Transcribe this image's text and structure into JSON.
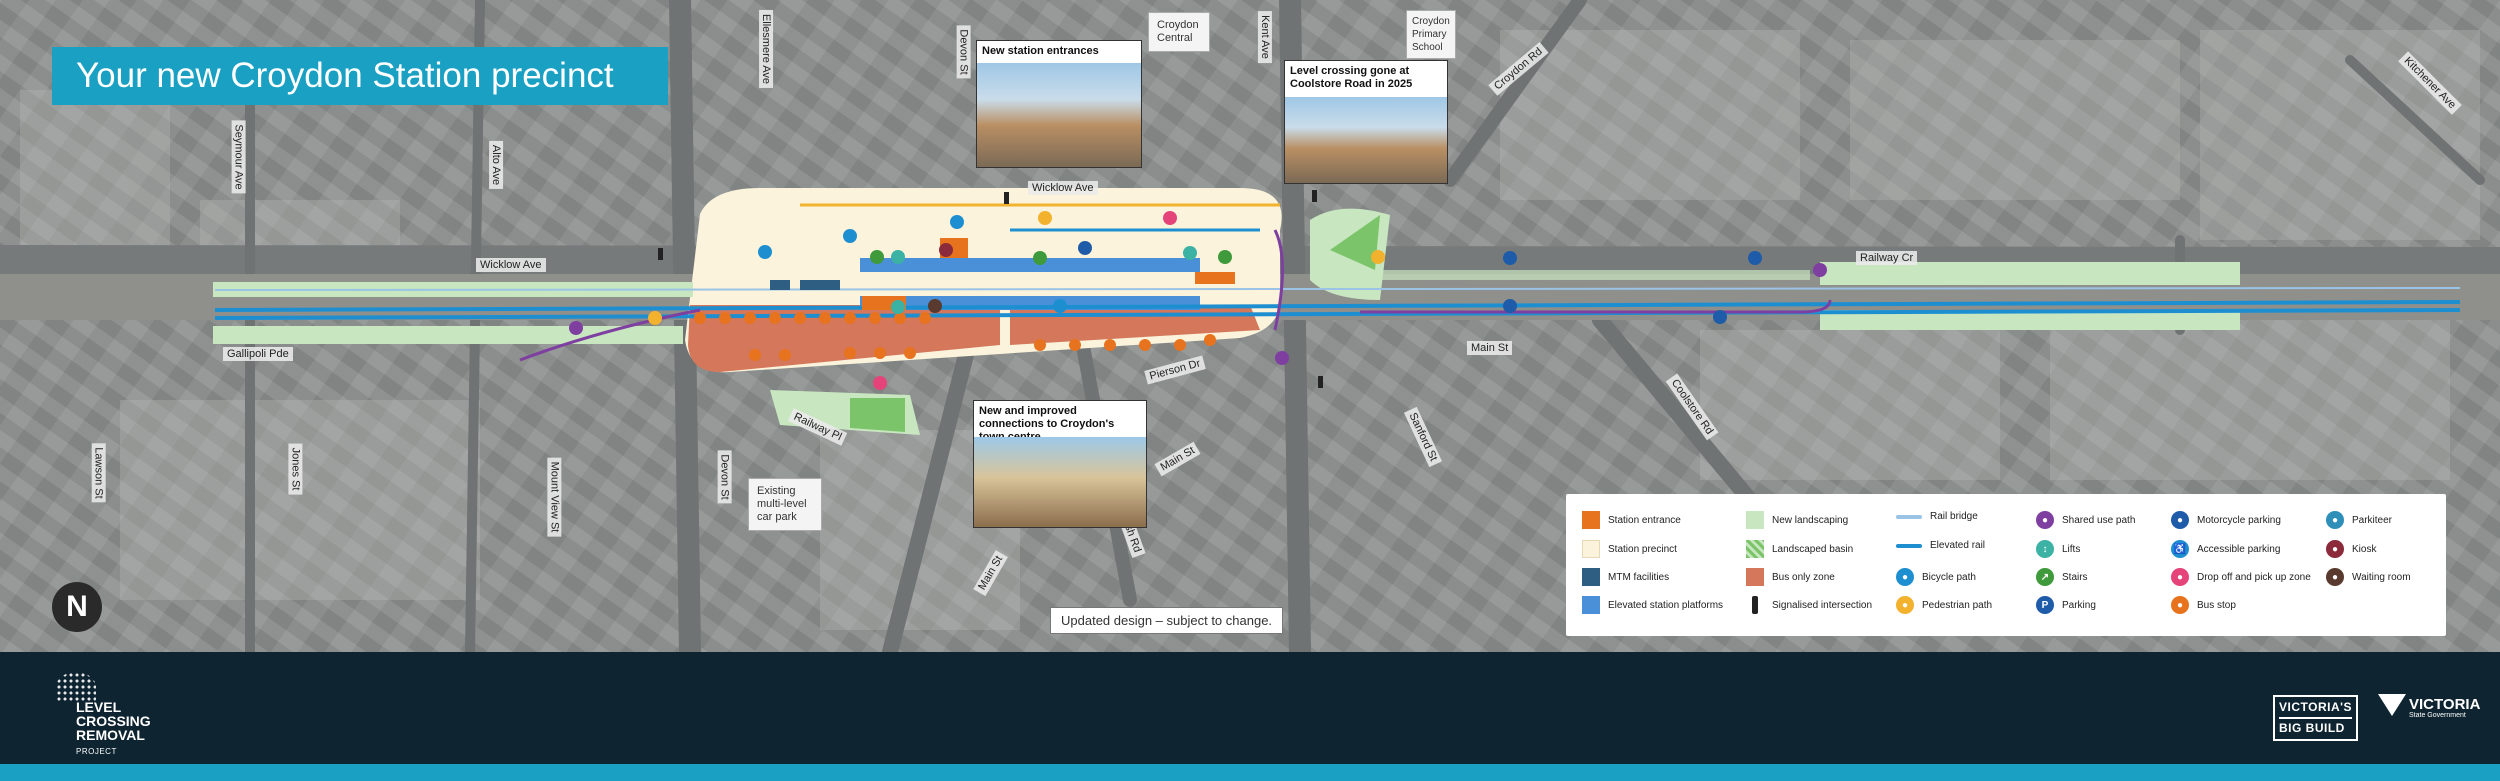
{
  "title": "Your new Croydon Station precinct",
  "streets": {
    "wicklow_ave_left": "Wicklow Ave",
    "wicklow_ave_top": "Wicklow Ave",
    "gallipoli_pde": "Gallipoli Pde",
    "railway_cr": "Railway Cr",
    "main_st_right": "Main St",
    "main_st_lower": "Main St",
    "main_st_bottom": "Main St",
    "coolstore_rd": "Coolstore Rd",
    "croydon_rd": "Croydon Rd",
    "kent_ave": "Kent Ave",
    "devon_st": "Devon St",
    "ellesmere_ave": "Ellesmere Ave",
    "alto_ave": "Alto Ave",
    "seymour_ave": "Seymour Ave",
    "kitchener_ave": "Kitchener Ave",
    "railway_pl": "Railway Pl",
    "lawson_st": "Lawson St",
    "jones_st": "Jones St",
    "mount_view_st": "Mount View St",
    "hewish_rd": "Hewish Rd",
    "pierson_dr": "Pierson Dr",
    "devon_st_lower": "Devon St",
    "sanford_st": "Sanford St"
  },
  "places": {
    "croydon_central": "Croydon Central",
    "croydon_primary_school": "Croydon Primary School",
    "existing_car_park": "Existing multi-level car park"
  },
  "callouts": {
    "new_entrances": "New station entrances",
    "level_crossing": "Level crossing gone at Coolstore Road in 2025",
    "connections": "New and improved connections to Croydon's town centre"
  },
  "note": "Updated design – subject to change.",
  "legend": [
    {
      "label": "Station entrance",
      "icon": "station-entrance-swatch",
      "color": "#e8731e"
    },
    {
      "label": "Station precinct",
      "icon": "station-precinct-swatch",
      "color": "#fbf3dc"
    },
    {
      "label": "MTM facilities",
      "icon": "mtm-facilities-swatch",
      "color": "#2e5f82"
    },
    {
      "label": "Elevated station platforms",
      "icon": "elevated-platforms-swatch",
      "color": "#4a90d9"
    },
    {
      "label": "New landscaping",
      "icon": "new-landscaping-swatch",
      "color": "#c8e6c0"
    },
    {
      "label": "Landscaped basin",
      "icon": "landscaped-basin-swatch",
      "color": "#7cc46a"
    },
    {
      "label": "Bus only zone",
      "icon": "bus-only-zone-swatch",
      "color": "#d4775a"
    },
    {
      "label": "Signalised intersection",
      "icon": "traffic-light-icon",
      "color": "#222222"
    },
    {
      "label": "Rail bridge",
      "icon": "rail-bridge-line",
      "color": "#9ac3e6"
    },
    {
      "label": "Elevated rail",
      "icon": "elevated-rail-line",
      "color": "#1d8fd1"
    },
    {
      "label": "Bicycle path",
      "icon": "bicycle-path-icon",
      "color": "#1d8fd1"
    },
    {
      "label": "Pedestrian path",
      "icon": "pedestrian-path-icon",
      "color": "#f2b22e"
    },
    {
      "label": "Shared use path",
      "icon": "shared-use-path-icon",
      "color": "#7e3fa1"
    },
    {
      "label": "Lifts",
      "icon": "lift-icon",
      "color": "#3bb2a3"
    },
    {
      "label": "Stairs",
      "icon": "stairs-icon",
      "color": "#3e9a3a"
    },
    {
      "label": "Parking",
      "icon": "parking-icon",
      "color": "#1e5ba8"
    },
    {
      "label": "Motorcycle parking",
      "icon": "motorcycle-parking-icon",
      "color": "#1e5ba8"
    },
    {
      "label": "Accessible parking",
      "icon": "accessible-parking-icon",
      "color": "#1d8fd1"
    },
    {
      "label": "Drop off and pick up zone",
      "icon": "drop-off-icon",
      "color": "#e4447a"
    },
    {
      "label": "Bus stop",
      "icon": "bus-stop-icon",
      "color": "#e8731e"
    },
    {
      "label": "Parkiteer",
      "icon": "parkiteer-icon",
      "color": "#2e8fb8"
    },
    {
      "label": "Kiosk",
      "icon": "kiosk-icon",
      "color": "#8b2a3a"
    },
    {
      "label": "Waiting room",
      "icon": "waiting-room-icon",
      "color": "#5a3a2e"
    }
  ],
  "footer": {
    "lxrp_line1": "LEVEL",
    "lxrp_line2": "CROSSING",
    "lxrp_line3": "REMOVAL",
    "lxrp_line4": "PROJECT",
    "vbb_line1": "VICTORIA'S",
    "vbb_line2": "BIG BUILD",
    "vic_gov": "VICTORIA",
    "vic_gov_sub": "State Government"
  },
  "colors": {
    "banner": "#1aa0c2",
    "footer": "#0e2430",
    "rail": "#1d8fd1",
    "landscaping": "#c8e6c0"
  }
}
